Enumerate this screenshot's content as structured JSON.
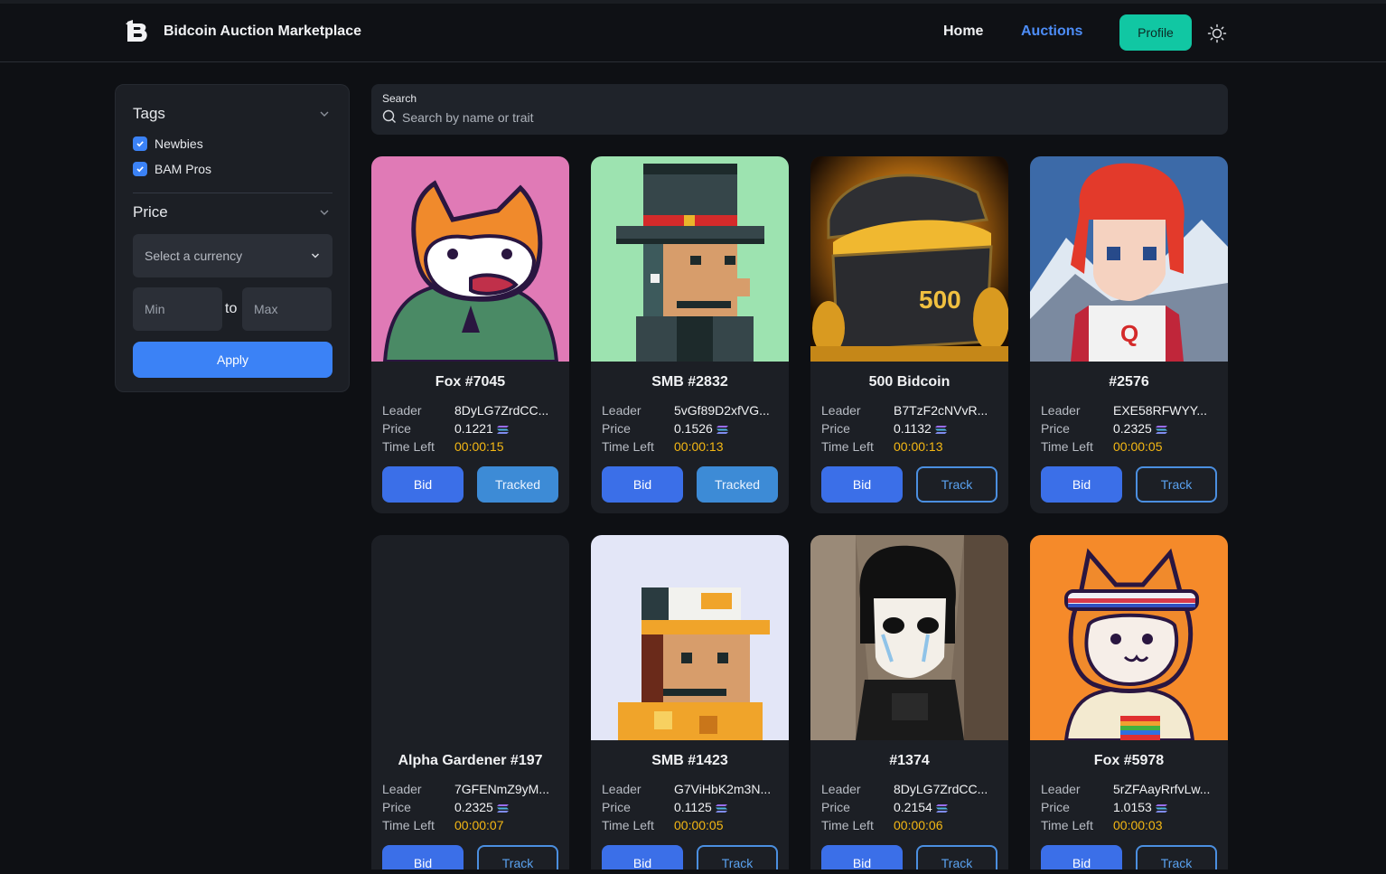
{
  "header": {
    "brand": "Bidcoin Auction Marketplace",
    "nav": {
      "home": "Home",
      "auctions": "Auctions"
    },
    "profile_label": "Profile",
    "accent": "#4d8df7",
    "profile_color": "#11c7a3"
  },
  "sidebar": {
    "tags_title": "Tags",
    "tags": [
      {
        "label": "Newbies",
        "checked": true
      },
      {
        "label": "BAM Pros",
        "checked": true
      }
    ],
    "price_title": "Price",
    "currency_placeholder": "Select a currency",
    "min_placeholder": "Min",
    "to_label": "to",
    "max_placeholder": "Max",
    "apply_label": "Apply"
  },
  "search": {
    "label": "Search",
    "placeholder": "Search by name or trait"
  },
  "labels": {
    "leader": "Leader",
    "price": "Price",
    "time_left": "Time Left",
    "bid": "Bid"
  },
  "cards": [
    {
      "name": "Fox #7045",
      "leader": "8DyLG7ZrdCC...",
      "price": "0.1221",
      "time_left": "00:00:15",
      "track": "Tracked",
      "image": "fox-pink"
    },
    {
      "name": "SMB #2832",
      "leader": "5vGf89D2xfVG...",
      "price": "0.1526",
      "time_left": "00:00:13",
      "track": "Tracked",
      "image": "pixel-tophat"
    },
    {
      "name": "500 Bidcoin",
      "leader": "B7TzF2cNVvR...",
      "price": "0.1132",
      "time_left": "00:00:13",
      "track": "Track",
      "image": "treasure-chest"
    },
    {
      "name": "#2576",
      "leader": "EXE58RFWYY...",
      "price": "0.2325",
      "time_left": "00:00:05",
      "track": "Track",
      "image": "anime-redhair"
    },
    {
      "name": "Alpha Gardener #197",
      "leader": "7GFENmZ9yM...",
      "price": "0.2325",
      "time_left": "00:00:07",
      "track": "Track",
      "image": "empty"
    },
    {
      "name": "SMB #1423",
      "leader": "G7ViHbK2m3N...",
      "price": "0.1125",
      "time_left": "00:00:05",
      "track": "Track",
      "image": "pixel-cap"
    },
    {
      "name": "#1374",
      "leader": "8DyLG7ZrdCC...",
      "price": "0.2154",
      "time_left": "00:00:06",
      "track": "Track",
      "image": "anime-crying"
    },
    {
      "name": "Fox #5978",
      "leader": "5rZFAayRrfvLw...",
      "price": "1.0153",
      "time_left": "00:00:03",
      "track": "Track",
      "image": "fox-orange"
    }
  ]
}
